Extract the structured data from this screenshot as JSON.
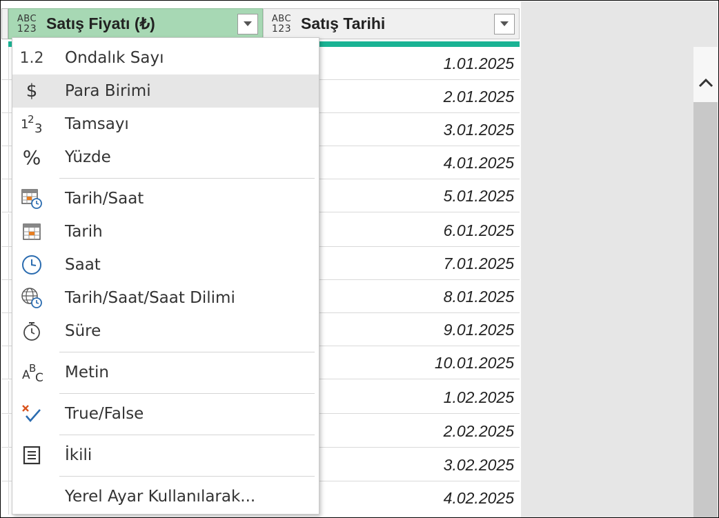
{
  "grid": {
    "columns": [
      {
        "type_badge_top": "ABC",
        "type_badge_bottom": "123",
        "title": "Satış Fiyatı (₺)",
        "active": true
      },
      {
        "type_badge_top": "ABC",
        "type_badge_bottom": "123",
        "title": "Satış Tarihi",
        "active": false
      }
    ],
    "dates": [
      "1.01.2025",
      "2.01.2025",
      "3.01.2025",
      "4.01.2025",
      "5.01.2025",
      "6.01.2025",
      "7.01.2025",
      "8.01.2025",
      "9.01.2025",
      "10.01.2025",
      "1.02.2025",
      "2.02.2025",
      "3.02.2025",
      "4.02.2025"
    ]
  },
  "type_menu": {
    "items": [
      {
        "label": "Ondalık Sayı",
        "icon": "decimal-icon"
      },
      {
        "label": "Para Birimi",
        "icon": "currency-icon",
        "highlighted": true
      },
      {
        "label": "Tamsayı",
        "icon": "whole-number-icon"
      },
      {
        "label": "Yüzde",
        "icon": "percent-icon"
      },
      {
        "label": "Tarih/Saat",
        "icon": "datetime-icon"
      },
      {
        "label": "Tarih",
        "icon": "date-icon"
      },
      {
        "label": "Saat",
        "icon": "time-icon"
      },
      {
        "label": "Tarih/Saat/Saat Dilimi",
        "icon": "datetime-timezone-icon"
      },
      {
        "label": "Süre",
        "icon": "duration-icon"
      },
      {
        "label": "Metin",
        "icon": "text-icon"
      },
      {
        "label": "True/False",
        "icon": "true-false-icon"
      },
      {
        "label": "İkili",
        "icon": "binary-icon"
      },
      {
        "label": "Yerel Ayar Kullanılarak...",
        "icon": ""
      }
    ],
    "glyphs": {
      "decimal": "1.2",
      "currency": "$",
      "percent": "%"
    }
  },
  "colors": {
    "active_header": "#a7d8b4",
    "accent_bar": "#1ab394",
    "highlight": "#e6e6e6"
  }
}
